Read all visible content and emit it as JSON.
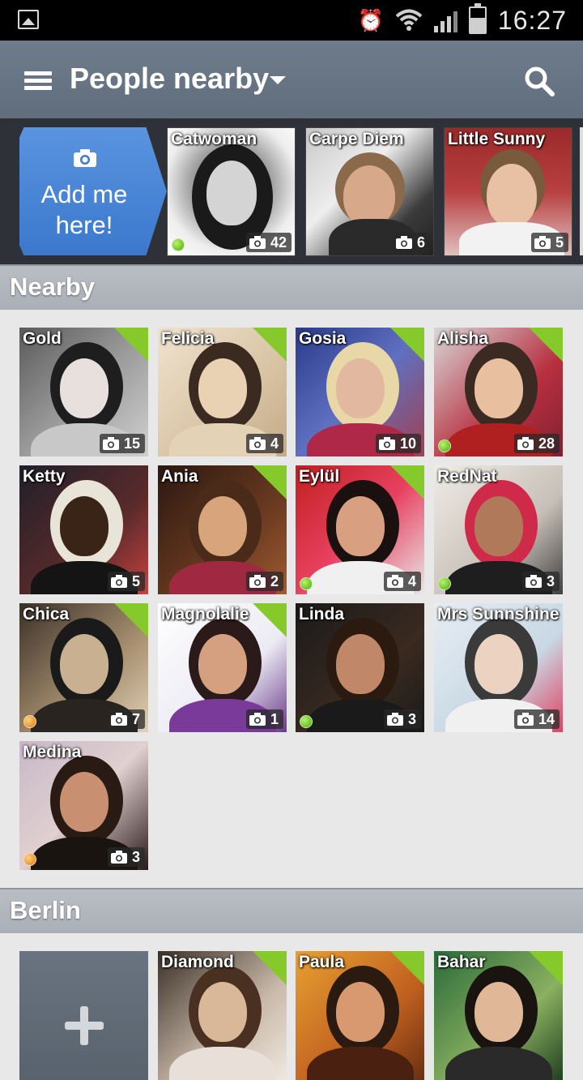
{
  "status_bar": {
    "time": "16:27"
  },
  "action_bar": {
    "title": "People nearby"
  },
  "promo": {
    "add_me_label_1": "Add me",
    "add_me_label_2": "here!",
    "tiles": [
      {
        "name": "Catwoman",
        "photos": "42",
        "online": "green"
      },
      {
        "name": "Carpe Diem",
        "photos": "6",
        "online": ""
      },
      {
        "name": "Little Sunny",
        "photos": "5",
        "online": ""
      }
    ]
  },
  "sections": {
    "nearby": {
      "title": "Nearby",
      "people": [
        {
          "name": "Gold",
          "photos": "15",
          "online": "",
          "new": true
        },
        {
          "name": "Felicia",
          "photos": "4",
          "online": "",
          "new": true
        },
        {
          "name": "Gosia",
          "photos": "10",
          "online": "",
          "new": true
        },
        {
          "name": "Alisha",
          "photos": "28",
          "online": "green",
          "new": true
        },
        {
          "name": "Ketty",
          "photos": "5",
          "online": "",
          "new": false
        },
        {
          "name": "Ania",
          "photos": "2",
          "online": "",
          "new": true
        },
        {
          "name": "Eylül",
          "photos": "4",
          "online": "green",
          "new": true
        },
        {
          "name": "RedNat",
          "photos": "3",
          "online": "green",
          "new": false
        },
        {
          "name": "Chica",
          "photos": "7",
          "online": "orange",
          "new": true
        },
        {
          "name": "Magnolalie",
          "photos": "1",
          "online": "",
          "new": true
        },
        {
          "name": "Linda",
          "photos": "3",
          "online": "green",
          "new": false
        },
        {
          "name": "Mrs Sunnshine",
          "photos": "14",
          "online": "",
          "new": false
        },
        {
          "name": "Medina",
          "photos": "3",
          "online": "orange",
          "new": false
        }
      ]
    },
    "berlin": {
      "title": "Berlin",
      "people": [
        {
          "name": "Diamond",
          "new": true
        },
        {
          "name": "Paula",
          "new": true
        },
        {
          "name": "Bahar",
          "new": true
        }
      ]
    }
  },
  "colors": {
    "new_badge": "#86c92b",
    "online": "#5cb816",
    "away": "#e88a18",
    "add_button": "#4a86d6"
  }
}
